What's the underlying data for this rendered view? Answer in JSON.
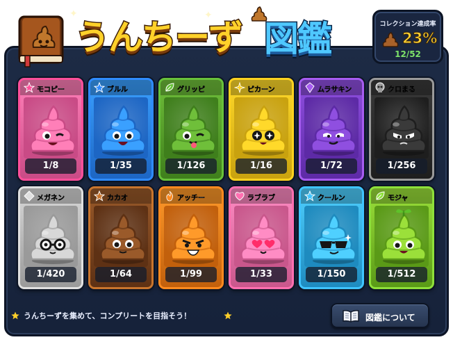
{
  "header": {
    "title_kana": "うんちーず",
    "title_kanji": "図鑑",
    "book_icon": "poop-book-icon"
  },
  "progress": {
    "label": "コレクション達成率",
    "percent": "23%",
    "count": "12/52",
    "icon": "poop-icon"
  },
  "cards": [
    {
      "name": "モコピー",
      "count": "1/8",
      "badge": "star",
      "badge_color": "#ff4f9a",
      "color": "#ff7fb8",
      "dark": "#c94b86",
      "face": "wink"
    },
    {
      "name": "ブルル",
      "count": "1/35",
      "badge": "star",
      "badge_color": "#2f8bff",
      "color": "#3aa0ff",
      "dark": "#1d66c4",
      "face": "happy"
    },
    {
      "name": "グリッピ",
      "count": "1/126",
      "badge": "leaf",
      "badge_color": "#68c23a",
      "color": "#6fbf3a",
      "dark": "#3f7f1c",
      "face": "tongue"
    },
    {
      "name": "ピカーン",
      "count": "1/16",
      "badge": "sparkle",
      "badge_color": "#ffd21f",
      "color": "#ffd92a",
      "dark": "#c9a20f",
      "face": "sparkle"
    },
    {
      "name": "ムラサキン",
      "count": "1/72",
      "badge": "crystal",
      "badge_color": "#a65cf0",
      "color": "#8f4fe0",
      "dark": "#5d2aa6",
      "face": "smug"
    },
    {
      "name": "クロまる",
      "count": "1/256",
      "badge": "skull",
      "badge_color": "#9a9a9a",
      "color": "#3a3a3a",
      "dark": "#1e1e1e",
      "face": "angry"
    },
    {
      "name": "メガネン",
      "count": "1/420",
      "badge": "diamond",
      "badge_color": "#e0e0e0",
      "color": "#d8d8d8",
      "dark": "#9a9a9a",
      "face": "glasses"
    },
    {
      "name": "カカオ",
      "count": "1/64",
      "badge": "star",
      "badge_color": "#c9752d",
      "color": "#9a5a2a",
      "dark": "#5e3114",
      "face": "plain"
    },
    {
      "name": "アッチー",
      "count": "1/99",
      "badge": "flame",
      "badge_color": "#ff8a1f",
      "color": "#ff9a2a",
      "dark": "#c2600c",
      "face": "grin"
    },
    {
      "name": "ラブラブ",
      "count": "1/33",
      "badge": "heart",
      "badge_color": "#ff6fb0",
      "color": "#ff8cc4",
      "dark": "#c9578c",
      "face": "hearts"
    },
    {
      "name": "クールン",
      "count": "1/150",
      "badge": "star",
      "badge_color": "#3fc4ff",
      "color": "#4fd0ff",
      "dark": "#1e8bbf",
      "face": "shades"
    },
    {
      "name": "モジャ",
      "count": "1/512",
      "badge": "leaf",
      "badge_color": "#8ee03a",
      "color": "#9be03a",
      "dark": "#5a9a17",
      "face": "sprout"
    }
  ],
  "footer": {
    "tip": "うんちーずを集めて、コンプリートを目指そう！",
    "about_button": "図鑑について",
    "about_icon": "open-book-icon"
  },
  "colors": {
    "panel": "#1d2b45",
    "accent_gold": "#ffd12a",
    "accent_blue": "#4fc8ff",
    "progress_green": "#7ee36a"
  }
}
